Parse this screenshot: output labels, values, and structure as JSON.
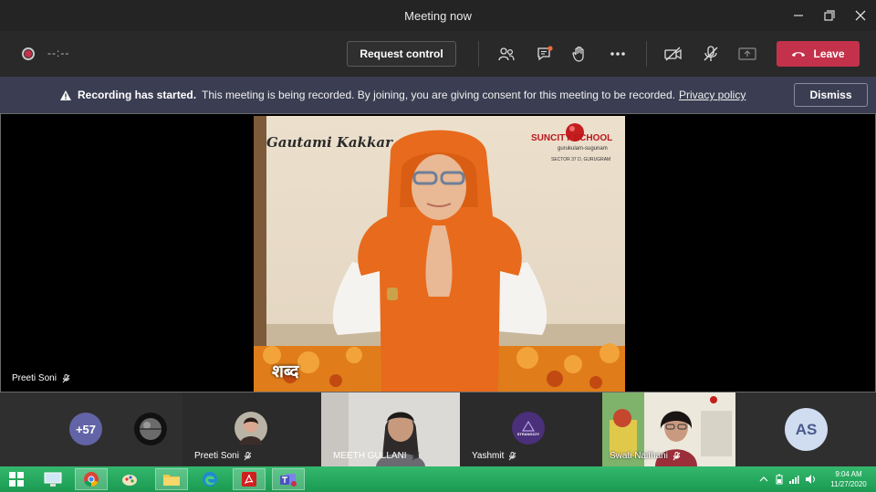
{
  "window": {
    "title": "Meeting now"
  },
  "toolbar": {
    "timer": "--:--",
    "request_control": "Request control",
    "leave": "Leave"
  },
  "banner": {
    "bold": "Recording has started.",
    "message": "This meeting is being recorded. By joining, you are giving consent for this meeting to be recorded.",
    "link": "Privacy policy",
    "dismiss": "Dismiss"
  },
  "stage": {
    "participant_name": "Preeti Soni",
    "video_overlay": {
      "name_caption": "Gautami Kakkar",
      "school_name": "SUNCITY SCHOOL",
      "school_tagline": "gurukulam-sugunam",
      "school_address": "SECTOR 37 D, GURUGRAM",
      "bottom_caption": "शब्द"
    }
  },
  "strip": {
    "more_count": "+57",
    "tiles": [
      {
        "name": "Preeti Soni"
      },
      {
        "name": "MEETH GULLANI"
      },
      {
        "name": "Yashmit",
        "avatar_text": "STRANGZZY"
      },
      {
        "name": "Swati Naithani"
      }
    ],
    "initials_avatar": "AS"
  },
  "taskbar": {
    "time": "9:04 AM",
    "date": "11/27/2020"
  },
  "colors": {
    "leave": "#c4314b",
    "banner": "#3b3e52",
    "more_avatar": "#6264a7",
    "initials_bg": "#d0dcf0",
    "initials_text": "#4a5a8a"
  }
}
